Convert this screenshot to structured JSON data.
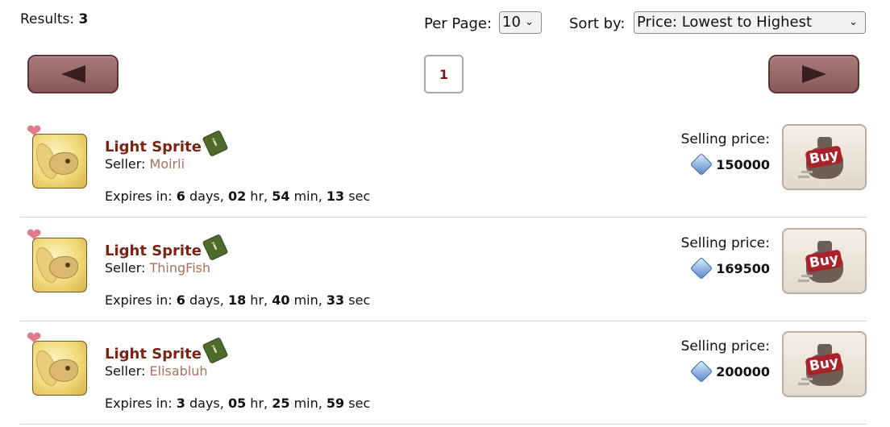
{
  "header": {
    "results_label": "Results:",
    "results_count": "3",
    "per_page_label": "Per Page:",
    "per_page_value": "10",
    "sort_label": "Sort by:",
    "sort_value": "Price: Lowest to Highest"
  },
  "pagination": {
    "current_page": "1"
  },
  "listings": [
    {
      "name": "Light Sprite",
      "seller_label": "Seller:",
      "seller": "Moirli",
      "expires_label": "Expires in:",
      "days": "6",
      "hr": "02",
      "min": "54",
      "sec": "13",
      "price_label": "Selling price:",
      "price": "150000",
      "buy_label": "Buy"
    },
    {
      "name": "Light Sprite",
      "seller_label": "Seller:",
      "seller": "ThingFish",
      "expires_label": "Expires in:",
      "days": "6",
      "hr": "18",
      "min": "40",
      "sec": "33",
      "price_label": "Selling price:",
      "price": "169500",
      "buy_label": "Buy"
    },
    {
      "name": "Light Sprite",
      "seller_label": "Seller:",
      "seller": "Elisabluh",
      "expires_label": "Expires in:",
      "days": "3",
      "hr": "05",
      "min": "25",
      "sec": "59",
      "price_label": "Selling price:",
      "price": "200000",
      "buy_label": "Buy"
    }
  ],
  "units": {
    "days": "days,",
    "hr": "hr,",
    "min": "min,",
    "sec": "sec"
  },
  "colors": {
    "item_name": "#7a2414",
    "seller_name": "#a8715a",
    "nav_button": "#8a5a5a",
    "buy_badge": "#a8232a"
  },
  "icons": {
    "favorite": "heart-icon",
    "info": "info-book-icon",
    "currency": "gem-icon",
    "buy": "money-bag-icon"
  }
}
